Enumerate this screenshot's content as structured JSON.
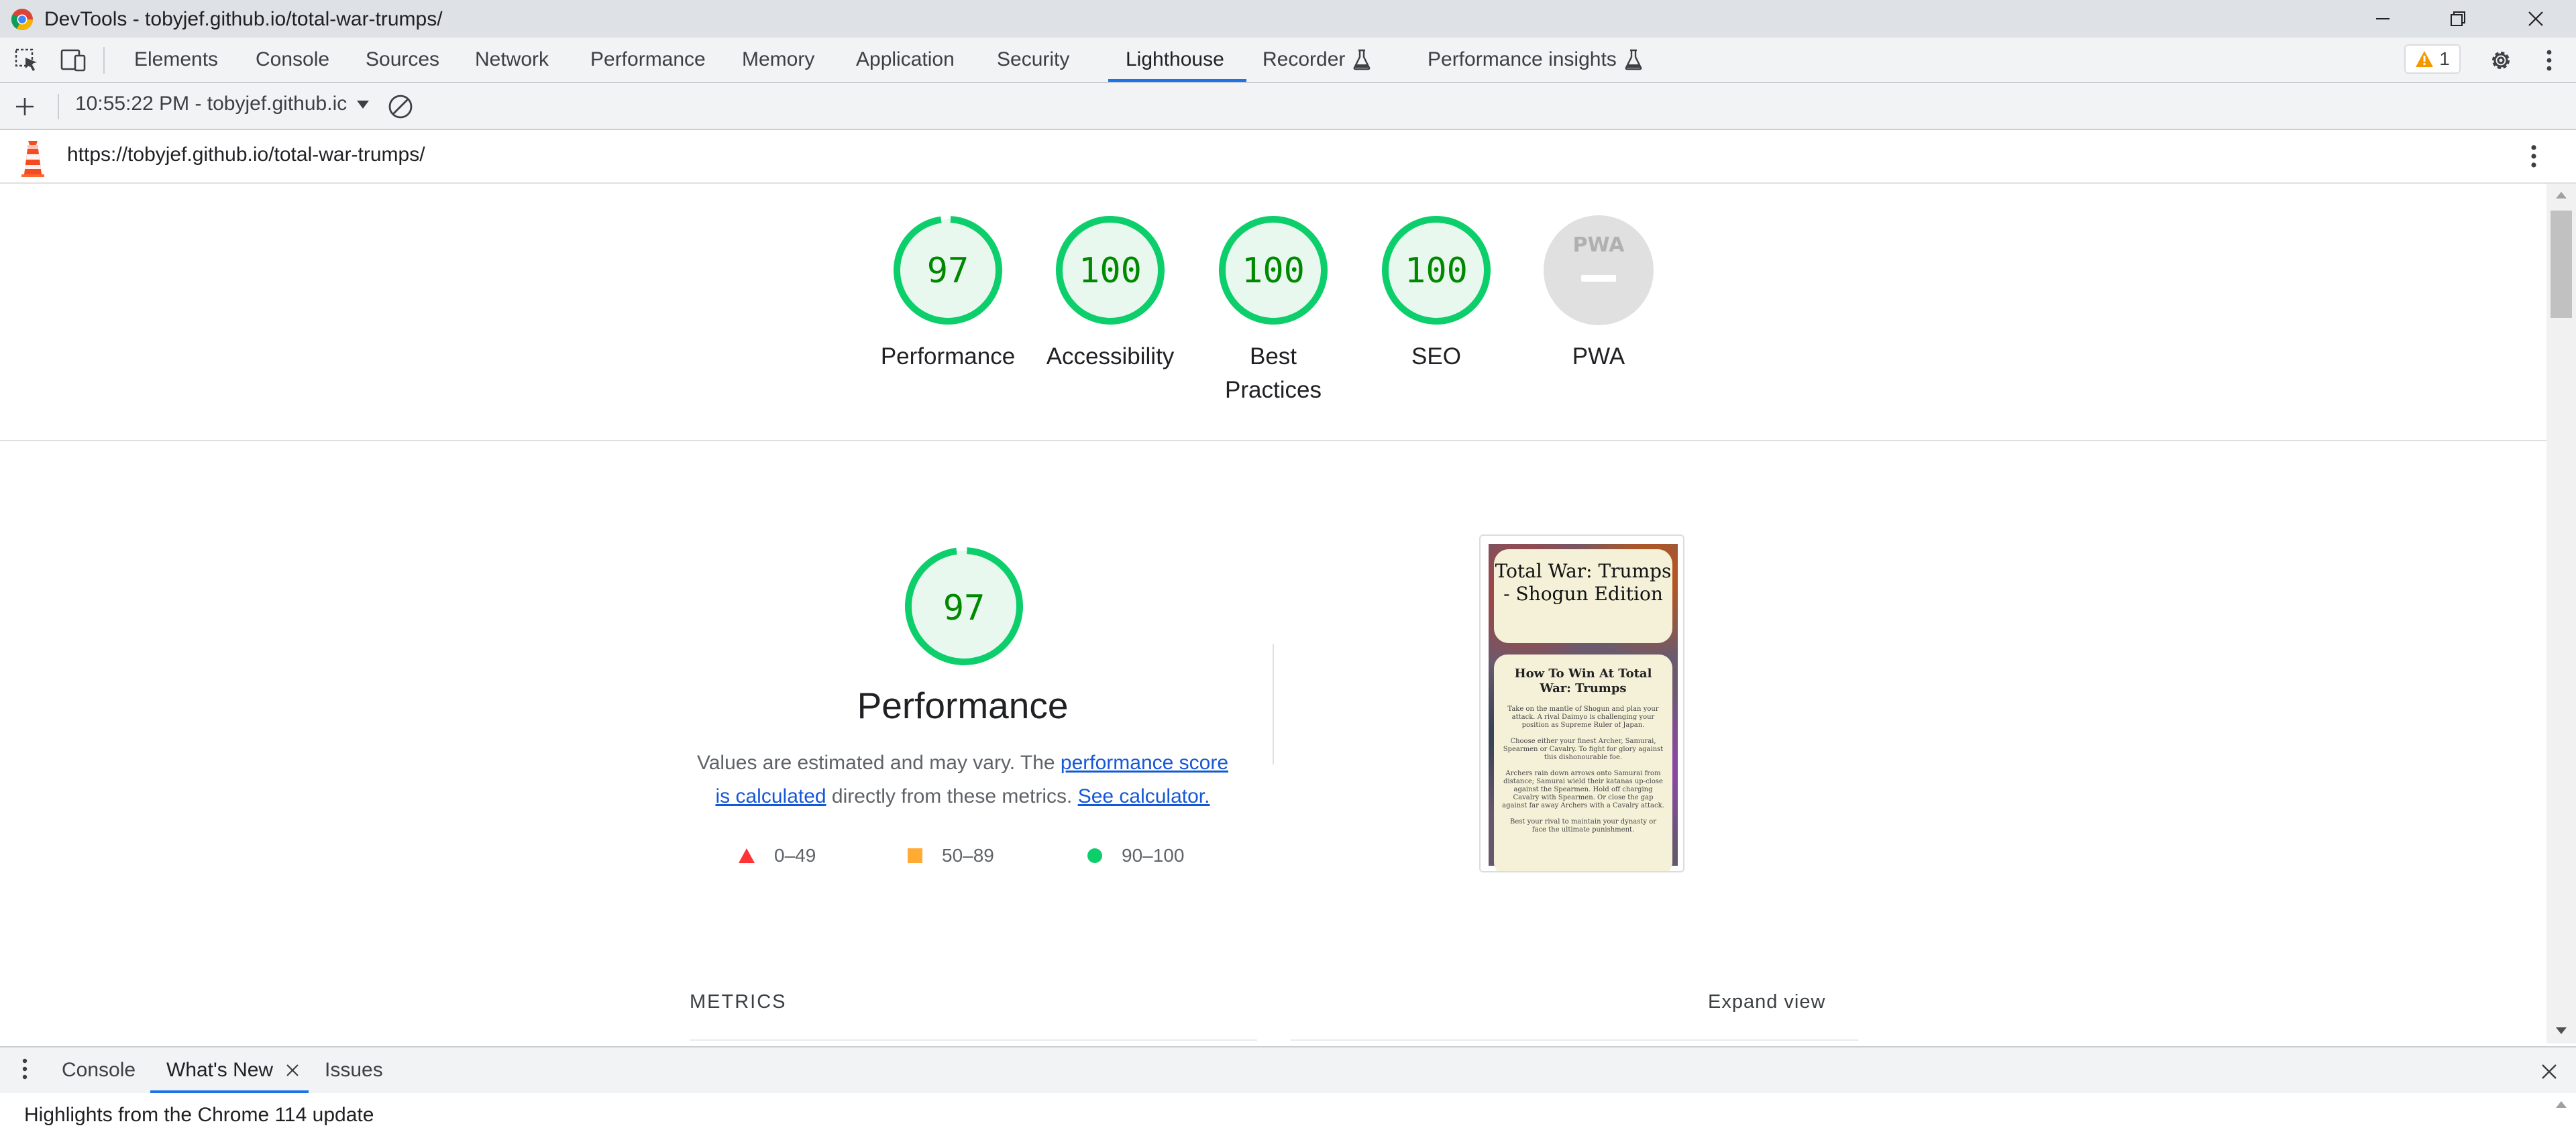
{
  "window": {
    "title": "DevTools - tobyjef.github.io/total-war-trumps/"
  },
  "tabs": [
    {
      "label": "Elements"
    },
    {
      "label": "Console"
    },
    {
      "label": "Sources"
    },
    {
      "label": "Network"
    },
    {
      "label": "Performance"
    },
    {
      "label": "Memory"
    },
    {
      "label": "Application"
    },
    {
      "label": "Security"
    },
    {
      "label": "Lighthouse",
      "active": true
    },
    {
      "label": "Recorder"
    },
    {
      "label": "Performance insights"
    }
  ],
  "toolbar": {
    "warning_count": "1"
  },
  "lighthouse": {
    "report_select": "10:55:22 PM - tobyjef.github.ic",
    "url": "https://tobyjef.github.io/total-war-trumps/"
  },
  "scores": [
    {
      "value": "97",
      "fraction": 0.97,
      "label_line1": "Performance",
      "label_line2": ""
    },
    {
      "value": "100",
      "fraction": 1.0,
      "label_line1": "Accessibility",
      "label_line2": ""
    },
    {
      "value": "100",
      "fraction": 1.0,
      "label_line1": "Best",
      "label_line2": "Practices"
    },
    {
      "value": "100",
      "fraction": 1.0,
      "label_line1": "SEO",
      "label_line2": ""
    }
  ],
  "pwa": {
    "badge": "PWA",
    "label": "PWA"
  },
  "performance": {
    "score": "97",
    "fraction": 0.97,
    "title": "Performance",
    "desc_before": "Values are estimated and may vary. The ",
    "desc_link1": "performance score is calculated",
    "desc_middle": " directly from these metrics. ",
    "desc_link2": "See calculator.",
    "legend": [
      {
        "range": "0–49",
        "color": "#ff3333",
        "shape": "triangle"
      },
      {
        "range": "50–89",
        "color": "#ffaa33",
        "shape": "square"
      },
      {
        "range": "90–100",
        "color": "#0cce6b",
        "shape": "circle"
      }
    ]
  },
  "screenshot": {
    "title": "Total War: Trumps - Shogun Edition",
    "heading": "How To Win At Total War: Trumps",
    "paragraphs": [
      "Take on the mantle of Shogun and plan your attack. A rival Daimyo is challenging your position as Supreme Ruler of Japan.",
      "Choose either your finest Archer, Samurai, Spearmen or Cavalry. To fight for glory against this dishonourable foe.",
      "Archers rain down arrows onto Samurai from distance; Samurai wield their katanas up-close against the Spearmen. Hold off charging Cavalry with Spearmen. Or close the gap against far away Archers with a Cavalry attack.",
      "Best your rival to maintain your dynasty or face the ultimate punishment."
    ]
  },
  "metrics": {
    "label": "METRICS",
    "expand": "Expand view"
  },
  "drawer": {
    "tabs": [
      {
        "label": "Console"
      },
      {
        "label": "What's New",
        "active": true
      },
      {
        "label": "Issues"
      }
    ],
    "message": "Highlights from the Chrome 114 update"
  },
  "colors": {
    "pass": "#0cce6b",
    "pass_text": "#008800",
    "pass_fill": "#e8f8ee",
    "accent": "#1a73e8",
    "warning": "#f29900"
  }
}
